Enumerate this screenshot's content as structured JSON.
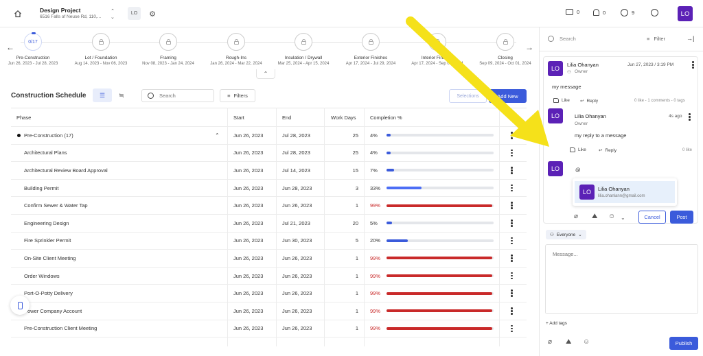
{
  "header": {
    "project_title": "Design Project",
    "project_address": "6516 Falls of Neuse Rd, 110,...",
    "user_initials": "LO",
    "messages_count": "0",
    "notifications_count": "0",
    "alerts_count": "9",
    "avatar_initials": "LO"
  },
  "timeline": {
    "stages": [
      {
        "name": "Pre-Construction",
        "dates": "Jun 26, 2023 - Jul 28, 2023",
        "node": "0/17"
      },
      {
        "name": "Lot / Foundation",
        "dates": "Aug 14, 2023 - Nov 06, 2023",
        "node": ""
      },
      {
        "name": "Framing",
        "dates": "Nov 08, 2023 - Jan 24, 2024",
        "node": ""
      },
      {
        "name": "Rough-Ins",
        "dates": "Jan 26, 2024 - Mar 22, 2024",
        "node": ""
      },
      {
        "name": "Insulation / Drywall",
        "dates": "Mar 25, 2024 - Apr 15, 2024",
        "node": ""
      },
      {
        "name": "Exterior Finishes",
        "dates": "Apr 17, 2024 - Jul 29, 2024",
        "node": ""
      },
      {
        "name": "Interior Finishes",
        "dates": "Apr 17, 2024 - Sep 05, 2024",
        "node": ""
      },
      {
        "name": "Closing",
        "dates": "Sep 09, 2024 - Oct 01, 2024",
        "node": ""
      }
    ]
  },
  "schedule": {
    "title": "Construction Schedule",
    "search_placeholder": "Search",
    "filters_label": "Filters",
    "selections_label": "Selections",
    "add_new_label": "Add New",
    "columns": [
      "Phase",
      "Start",
      "End",
      "Work Days",
      "Completion %"
    ],
    "group": {
      "name": "Pre-Construction (17)",
      "start": "Jun 26, 2023",
      "end": "Jul 28, 2023",
      "days": "25",
      "pct": "4%",
      "value": 4,
      "color": "#3b5bdb"
    },
    "rows": [
      {
        "name": "Architectural Plans",
        "start": "Jun 26, 2023",
        "end": "Jul 28, 2023",
        "days": "25",
        "pct": "4%",
        "value": 4,
        "color": "#3b5bdb"
      },
      {
        "name": "Architectural Review Board Approval",
        "start": "Jun 26, 2023",
        "end": "Jul 14, 2023",
        "days": "15",
        "pct": "7%",
        "value": 7,
        "color": "#3b5bdb"
      },
      {
        "name": "Building Permit",
        "start": "Jun 26, 2023",
        "end": "Jun 28, 2023",
        "days": "3",
        "pct": "33%",
        "value": 33,
        "color": "#4c6ef5"
      },
      {
        "name": "Confirm Sewer & Water Tap",
        "start": "Jun 26, 2023",
        "end": "Jun 26, 2023",
        "days": "1",
        "pct": "99%",
        "value": 99,
        "color": "#c92a2a"
      },
      {
        "name": "Engineering Design",
        "start": "Jun 26, 2023",
        "end": "Jul 21, 2023",
        "days": "20",
        "pct": "5%",
        "value": 5,
        "color": "#3b5bdb"
      },
      {
        "name": "Fire Sprinkler Permit",
        "start": "Jun 26, 2023",
        "end": "Jun 30, 2023",
        "days": "5",
        "pct": "20%",
        "value": 20,
        "color": "#3b5bdb"
      },
      {
        "name": "On-Site Client Meeting",
        "start": "Jun 26, 2023",
        "end": "Jun 26, 2023",
        "days": "1",
        "pct": "99%",
        "value": 99,
        "color": "#c92a2a"
      },
      {
        "name": "Order Windows",
        "start": "Jun 26, 2023",
        "end": "Jun 26, 2023",
        "days": "1",
        "pct": "99%",
        "value": 99,
        "color": "#c92a2a"
      },
      {
        "name": "Port-O-Potty Delivery",
        "start": "Jun 26, 2023",
        "end": "Jun 26, 2023",
        "days": "1",
        "pct": "99%",
        "value": 99,
        "color": "#c92a2a"
      },
      {
        "name": "Power Company Account",
        "start": "Jun 26, 2023",
        "end": "Jun 26, 2023",
        "days": "1",
        "pct": "99%",
        "value": 99,
        "color": "#c92a2a"
      },
      {
        "name": "Pre-Construction Client Meeting",
        "start": "Jun 26, 2023",
        "end": "Jun 26, 2023",
        "days": "1",
        "pct": "99%",
        "value": 99,
        "color": "#c92a2a"
      }
    ]
  },
  "panel": {
    "search_placeholder": "Search",
    "filter_label": "Filter",
    "comment": {
      "initials": "LO",
      "name": "Lilia Ohanyan",
      "role": "Owner",
      "date": "Jun 27, 2023 / 3:19 PM",
      "body": "my message",
      "like_label": "Like",
      "reply_label": "Reply",
      "meta": "0 like - 1 comments - 0 tags"
    },
    "reply": {
      "initials": "LO",
      "name": "Lilia Ohanyan",
      "role": "Owner",
      "time": "4s ago",
      "body": "my reply to a message",
      "like_label": "Like",
      "reply_label": "Reply",
      "meta": "0 like"
    },
    "compose": {
      "initials": "LO",
      "value": "@",
      "mention_initials": "LO",
      "mention_name": "Lilia Ohanyan",
      "mention_email": "lilia.ohanlann@gmail.com",
      "cancel_label": "Cancel",
      "post_label": "Post"
    },
    "audience_label": "Everyone",
    "message_placeholder": "Message...",
    "add_tags_label": "Add tags",
    "publish_label": "Publish"
  },
  "colors": {
    "accent": "#3b5bdb",
    "avatar": "#5b21b6",
    "overdue": "#c92a2a",
    "arrow": "#f5e11a"
  }
}
